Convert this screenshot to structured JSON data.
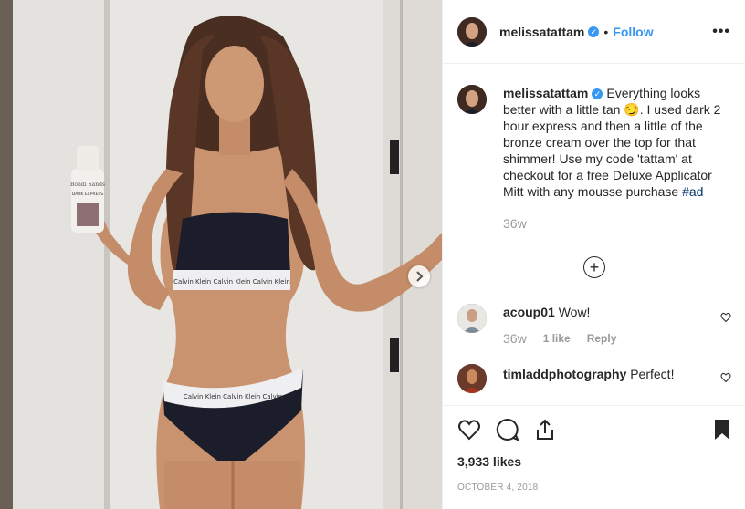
{
  "post": {
    "username": "melissatattam",
    "follow_label": "Follow",
    "dot": "•",
    "more_label": "•••"
  },
  "caption": {
    "username": "melissatattam",
    "text_before_emoji": "Everything looks better with a little tan",
    "emoji": "😏",
    "text_after_emoji": ". I used dark 2 hour express and then a little of the bronze cream over the top for that shimmer! Use my code 'tattam' at checkout for a free Deluxe Applicator Mitt with any mousse purchase",
    "hashtag": "#ad",
    "age": "36w"
  },
  "load_more_label": "+",
  "comments": [
    {
      "username": "acoup01",
      "text": "Wow!",
      "age": "36w",
      "likes": "1 like",
      "reply_label": "Reply"
    },
    {
      "username": "timladdphotography",
      "text": "Perfect!"
    }
  ],
  "footer": {
    "likes": "3,933 likes",
    "date": "OCTOBER 4, 2018"
  },
  "photo": {
    "product_label_top": "Bondi Sands",
    "product_label_mid": "DARK EXPRESS",
    "bra_band_text": "Calvin Klein  Calvin Klein  Calvin Klein",
    "brief_band_text": "Calvin Klein    Calvin Klein    Calvin"
  },
  "colors": {
    "accent": "#3897f0",
    "hashtag": "#003569",
    "muted": "#999999",
    "text": "#262626"
  }
}
